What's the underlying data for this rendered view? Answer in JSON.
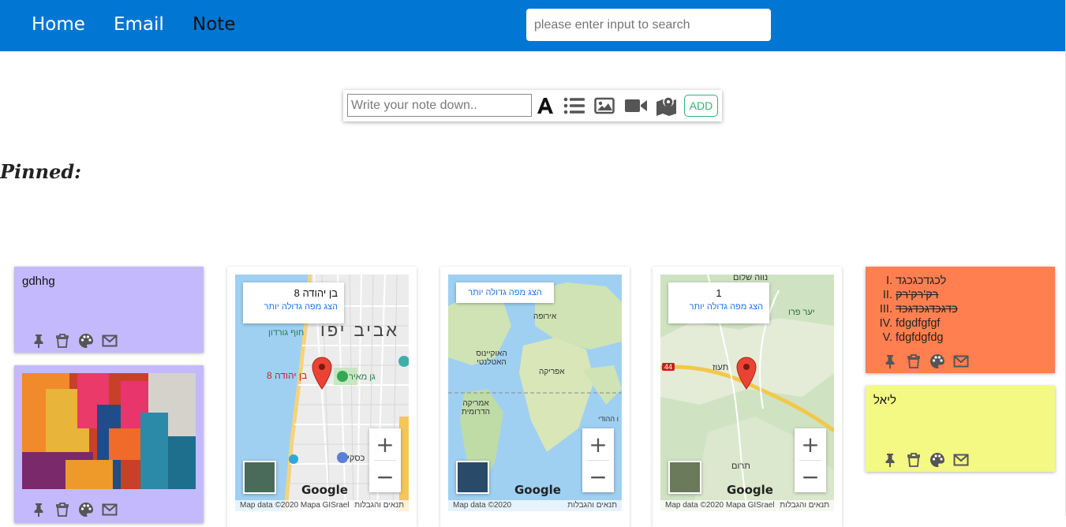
{
  "nav": {
    "items": [
      {
        "label": "Home",
        "active": false
      },
      {
        "label": "Email",
        "active": false
      },
      {
        "label": "Note",
        "active": true
      }
    ],
    "search_placeholder": "please enter input to search"
  },
  "composer": {
    "placeholder": "Write your note down..",
    "tools": [
      "text-icon",
      "list-icon",
      "image-icon",
      "video-icon",
      "map-icon"
    ],
    "add_label": "ADD"
  },
  "section": {
    "pinned_title": "Pinned:"
  },
  "colors": {
    "topbar": "#0176d3",
    "purple_note": "#c4b9fd",
    "orange_note": "#ff7f50",
    "yellow_note": "#f3f983",
    "add_green": "#2bb673"
  },
  "notes": {
    "text_note_1": {
      "text": "gdhhg"
    },
    "image_note": {
      "alt": "abstract painting"
    },
    "map_1": {
      "place": "בן יהודה 8",
      "bigger_map_link": "הצג מפה גדולה יותר",
      "city_label": "אביב יפו",
      "marker_label": "בן יהודה 8",
      "labels": [
        "חוף גורדון",
        "גן מאיר",
        "כסקי"
      ],
      "google": "Google",
      "footer_left": "Map data ©2020 Mapa GISrael",
      "footer_right": "תנאים והגבלות"
    },
    "map_2": {
      "bigger_map_link": "הצג מפה גדולה יותר",
      "labels": [
        "אירופה",
        "האוקיינוס האטלנטי",
        "אפריקה",
        "אמריקה הדרומית",
        "ו ההודי"
      ],
      "google": "Google",
      "footer_left": "Map data ©2020",
      "footer_right": "תנאים והגבלות"
    },
    "map_3": {
      "place": "1",
      "bigger_map_link": "הצג מפה גדולה יותר",
      "labels": [
        "נווה שלום",
        "יער פרו",
        "תעוז",
        "תרום",
        "44"
      ],
      "google": "Google",
      "footer_left": "Map data ©2020 Mapa GISrael",
      "footer_right": "תנאים והגבלות"
    },
    "list_note": {
      "items": [
        {
          "marker": "I.",
          "text": "לכגדכגכגד",
          "done": false
        },
        {
          "marker": "II.",
          "text": "רק'רק'רק",
          "done": true
        },
        {
          "marker": "III.",
          "text": "כדגכדגכדגכד",
          "done": true
        },
        {
          "marker": "IV.",
          "text": "fdgdfgfgf",
          "done": false
        },
        {
          "marker": "V.",
          "text": "fdgfdgfdg",
          "done": false
        }
      ]
    },
    "text_note_2": {
      "text": "ליאל"
    }
  },
  "action_icons": [
    "pin-icon",
    "trash-icon",
    "palette-icon",
    "mail-icon"
  ]
}
